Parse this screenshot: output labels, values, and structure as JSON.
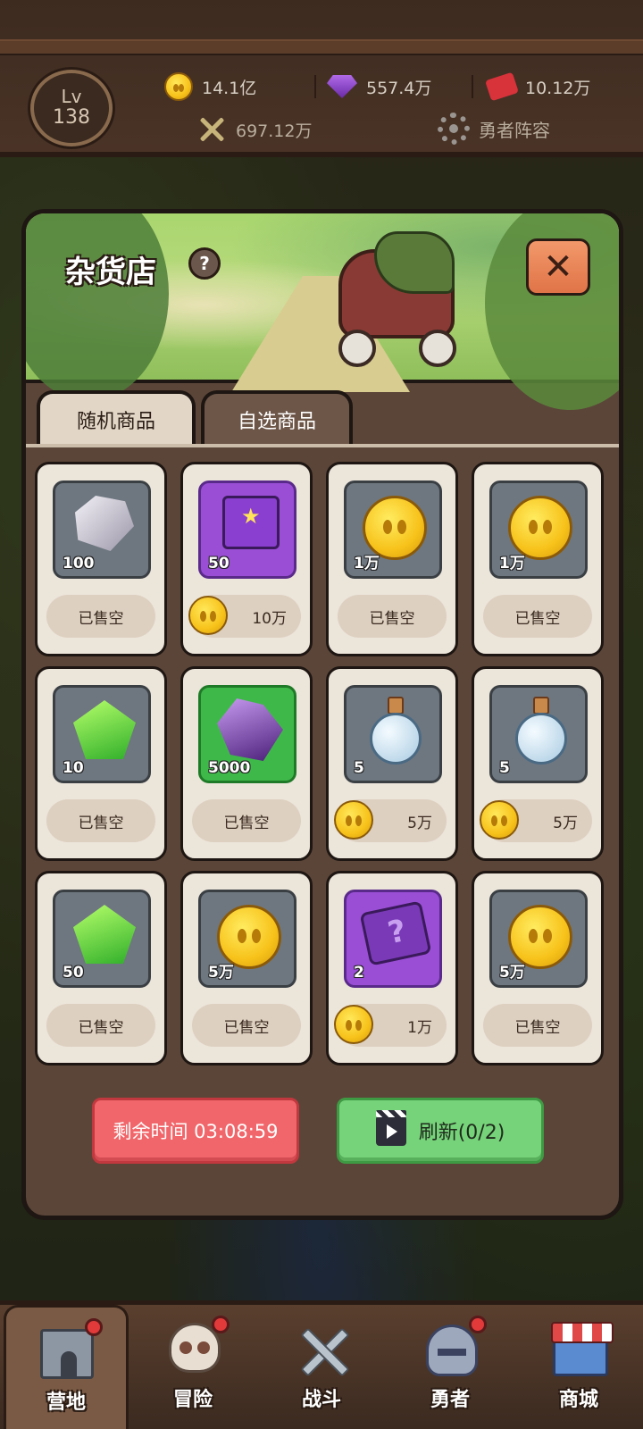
{
  "header": {
    "level_label": "Lv",
    "level_value": "138",
    "gold": "14.1亿",
    "gems": "557.4万",
    "tickets": "10.12万",
    "power": "697.12万",
    "lineup_label": "勇者阵容"
  },
  "shop": {
    "title": "杂货店",
    "help": "?",
    "close": "✕",
    "tabs": [
      "随机商品",
      "自选商品"
    ],
    "sold_out_label": "已售空",
    "items": [
      {
        "icon": "stone-icon",
        "qty": "100",
        "status": "sold"
      },
      {
        "icon": "book-icon",
        "qty": "50",
        "status": "buy",
        "price": "10万"
      },
      {
        "icon": "coin-icon",
        "qty": "1万",
        "status": "sold"
      },
      {
        "icon": "coin-icon",
        "qty": "1万",
        "status": "sold"
      },
      {
        "icon": "green-gem-icon",
        "qty": "10",
        "status": "sold"
      },
      {
        "icon": "purple-crystal-icon",
        "qty": "5000",
        "status": "sold"
      },
      {
        "icon": "potion-icon",
        "qty": "5",
        "status": "buy",
        "price": "5万"
      },
      {
        "icon": "potion-icon",
        "qty": "5",
        "status": "buy",
        "price": "5万"
      },
      {
        "icon": "green-gem-icon",
        "qty": "50",
        "status": "sold"
      },
      {
        "icon": "coin-icon",
        "qty": "5万",
        "status": "sold"
      },
      {
        "icon": "mystery-ticket-icon",
        "qty": "2",
        "status": "buy",
        "price": "1万"
      },
      {
        "icon": "coin-icon",
        "qty": "5万",
        "status": "sold"
      }
    ],
    "timer_label": "剩余时间 03:08:59",
    "refresh_label": "刷新(0/2)"
  },
  "nav": [
    {
      "label": "营地",
      "icon": "castle-icon",
      "active": true,
      "dot": true
    },
    {
      "label": "冒险",
      "icon": "skull-icon",
      "active": false,
      "dot": true
    },
    {
      "label": "战斗",
      "icon": "swords-icon",
      "active": false,
      "dot": false
    },
    {
      "label": "勇者",
      "icon": "helmet-icon",
      "active": false,
      "dot": true
    },
    {
      "label": "商城",
      "icon": "shop-icon",
      "active": false,
      "dot": false
    }
  ],
  "colors": {
    "modal_bg": "#5b4538",
    "card_bg": "#ece5da",
    "timer_btn": "#f0666a",
    "refresh_btn": "#76d37a",
    "gold": "#f7c21a"
  }
}
